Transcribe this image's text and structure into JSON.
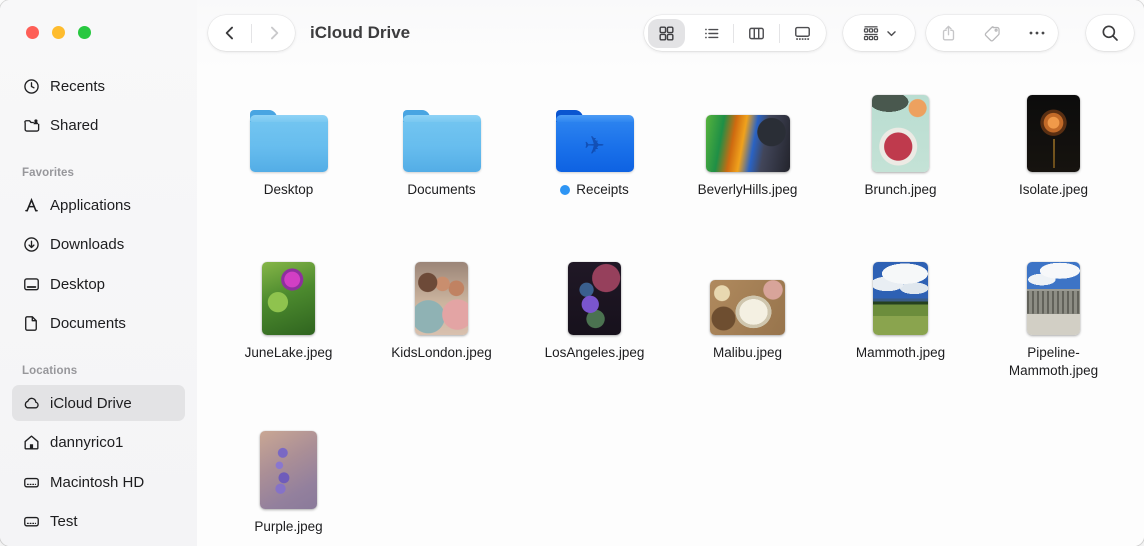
{
  "window": {
    "title": "iCloud Drive",
    "traffic_lights": {
      "close_color": "#fe5f57",
      "minimize_color": "#febc2e",
      "zoom_color": "#28c840"
    }
  },
  "toolbar": {
    "back_icon": "chevron-left-icon",
    "forward_icon": "chevron-right-icon",
    "view_buttons": [
      {
        "name": "icon-view",
        "icon": "grid-view-icon",
        "selected": true
      },
      {
        "name": "list-view",
        "icon": "list-view-icon",
        "selected": false
      },
      {
        "name": "column-view",
        "icon": "column-view-icon",
        "selected": false
      },
      {
        "name": "gallery-view",
        "icon": "gallery-view-icon",
        "selected": false
      }
    ],
    "group_button": {
      "icon": "group-items-icon",
      "chevron": "chevron-down-icon"
    },
    "share_button": {
      "icon": "share-icon",
      "disabled": true
    },
    "tag_button": {
      "icon": "tag-icon"
    },
    "more_button": {
      "icon": "ellipsis-icon"
    },
    "search_button": {
      "icon": "search-icon"
    }
  },
  "sidebar": {
    "pinned": [
      {
        "label": "Recents",
        "icon": "clock-icon"
      },
      {
        "label": "Shared",
        "icon": "shared-folder-icon"
      }
    ],
    "sections": [
      {
        "title": "Favorites",
        "items": [
          {
            "label": "Applications",
            "icon": "app-store-icon"
          },
          {
            "label": "Downloads",
            "icon": "download-circle-icon"
          },
          {
            "label": "Desktop",
            "icon": "desktop-icon"
          },
          {
            "label": "Documents",
            "icon": "document-icon"
          }
        ]
      },
      {
        "title": "Locations",
        "items": [
          {
            "label": "iCloud Drive",
            "icon": "cloud-icon",
            "selected": true
          },
          {
            "label": "dannyrico1",
            "icon": "home-icon"
          },
          {
            "label": "Macintosh HD",
            "icon": "hard-drive-icon"
          },
          {
            "label": "Test",
            "icon": "hard-drive-icon"
          }
        ]
      }
    ]
  },
  "files": {
    "folder_color": "#67bdee",
    "tagged_folder_color": "#1a71ea",
    "tag_color": "#2e95f4",
    "items": [
      {
        "name": "Desktop",
        "kind": "folder"
      },
      {
        "name": "Documents",
        "kind": "folder"
      },
      {
        "name": "Receipts",
        "kind": "folder",
        "emblem": "airplane-icon",
        "tag": "blue"
      },
      {
        "name": "BeverlyHills.jpeg",
        "kind": "image"
      },
      {
        "name": "Brunch.jpeg",
        "kind": "image"
      },
      {
        "name": "Isolate.jpeg",
        "kind": "image"
      },
      {
        "name": "JuneLake.jpeg",
        "kind": "image"
      },
      {
        "name": "KidsLondon.jpeg",
        "kind": "image"
      },
      {
        "name": "LosAngeles.jpeg",
        "kind": "image"
      },
      {
        "name": "Malibu.jpeg",
        "kind": "image"
      },
      {
        "name": "Mammoth.jpeg",
        "kind": "image"
      },
      {
        "name": "Pipeline-Mammoth.jpeg",
        "kind": "image"
      },
      {
        "name": "Purple.jpeg",
        "kind": "image"
      }
    ]
  }
}
